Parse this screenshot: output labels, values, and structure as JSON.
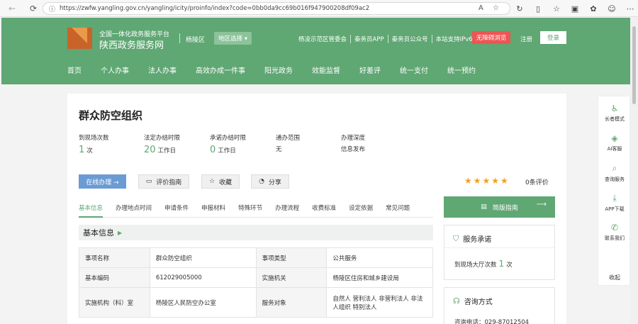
{
  "browser": {
    "url": "https://zwfw.yangling.gov.cn/yangling/icity/proinfo/index?code=0bb0da9cc69b016f947900208df09ac2",
    "icons": [
      "back-icon",
      "refresh-icon",
      "info-icon",
      "read-aloud-icon",
      "favorite-icon",
      "refresh-page-icon",
      "split-icon",
      "favorites-icon",
      "collections-icon",
      "extensions-icon",
      "sidebar-icon"
    ]
  },
  "header": {
    "site_line1": "全国一体化政务服务平台",
    "site_line2": "陕西政务服务网",
    "region": "杨陵区",
    "region_select": "地区选择 ▾",
    "links": [
      "杨凌示范区管委会",
      "秦务员APP",
      "秦务员公众号",
      "本站支持IPv6"
    ],
    "barrier_free": "无障碍浏览",
    "register": "注册",
    "login": "登录",
    "nav": [
      "首页",
      "个人办事",
      "法人办事",
      "高效办成一件事",
      "阳光政务",
      "效能监督",
      "好差评",
      "统一支付",
      "统一预约"
    ]
  },
  "item": {
    "title": "群众防空组织",
    "stats": [
      {
        "label": "到现场次数",
        "num": "1",
        "unit": "次"
      },
      {
        "label": "法定办结时限",
        "num": "20",
        "unit": "工作日"
      },
      {
        "label": "承诺办结时限",
        "num": "0",
        "unit": "工作日"
      },
      {
        "label": "通办范围",
        "num": "",
        "unit": "无"
      },
      {
        "label": "办理深度",
        "num": "",
        "unit": "信息发布"
      }
    ],
    "btn_online": "在线办理  →",
    "btn_guide": "评价指南",
    "btn_fav": "收藏",
    "btn_share": "分享",
    "rating_stars": 5,
    "eval_count": "0条评价"
  },
  "detail": {
    "tabs": [
      "基本信息",
      "办理地点时间",
      "申请条件",
      "申报材料",
      "特殊环节",
      "办理流程",
      "收费标准",
      "设定依据",
      "常见问题"
    ],
    "section_title": "基本信息",
    "rows": [
      [
        "事项名称",
        "群众防空组织",
        "事项类型",
        "公共服务"
      ],
      [
        "基本编码",
        "612029005000",
        "实施机关",
        "杨陵区住房和城乡建设局"
      ],
      [
        "实施机构（科）室",
        "杨陵区人民防空办公室",
        "服务对象",
        "自然人 营利法人 非营利法人 非法人组织 特别法人"
      ]
    ]
  },
  "side": {
    "guide": "简版指南",
    "promise_title": "服务承诺",
    "promise_text": "到现场大厅次数",
    "promise_num": "1",
    "promise_unit": "次",
    "consult_title": "咨询方式",
    "consult_text": "咨询电话：029-87012504"
  },
  "float": [
    "长者模式",
    "AI客服",
    "查询服务",
    "APP下载",
    "联系我们",
    "收起"
  ],
  "colors": {
    "brand": "#5fa773",
    "accent_blue": "#6b9bd3",
    "star": "#f0a020",
    "barrier": "#ee5555"
  }
}
